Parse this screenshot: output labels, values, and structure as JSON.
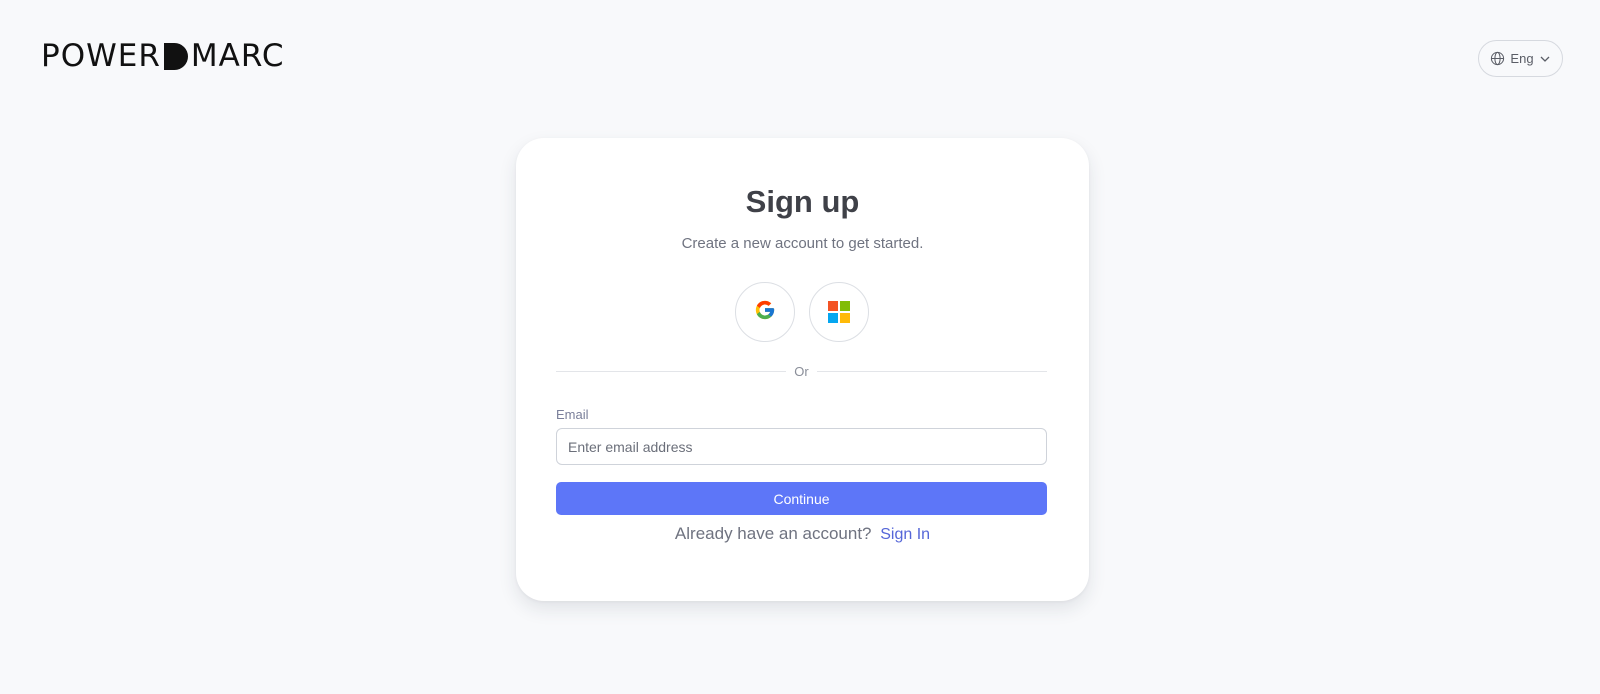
{
  "brand": {
    "logo_left": "POWER",
    "logo_right": "MARC"
  },
  "language": {
    "selected": "Eng",
    "icon": "globe-icon",
    "chevron_icon": "chevron-down-icon"
  },
  "signup": {
    "title": "Sign up",
    "subtitle": "Create a new account to get started.",
    "social": [
      {
        "name": "Google",
        "icon": "google-icon"
      },
      {
        "name": "Microsoft",
        "icon": "microsoft-icon"
      }
    ],
    "divider_text": "Or",
    "email_label": "Email",
    "email_placeholder": "Enter email address",
    "email_value": "",
    "continue_label": "Continue",
    "have_account_text": "Already have an account?",
    "signin_link": "Sign In"
  },
  "colors": {
    "background": "#f8f9fb",
    "card": "#ffffff",
    "primary": "#5d76f8",
    "link": "#5566d8",
    "microsoft": [
      "#f35325",
      "#81bc06",
      "#05a6f0",
      "#ffba08"
    ]
  }
}
